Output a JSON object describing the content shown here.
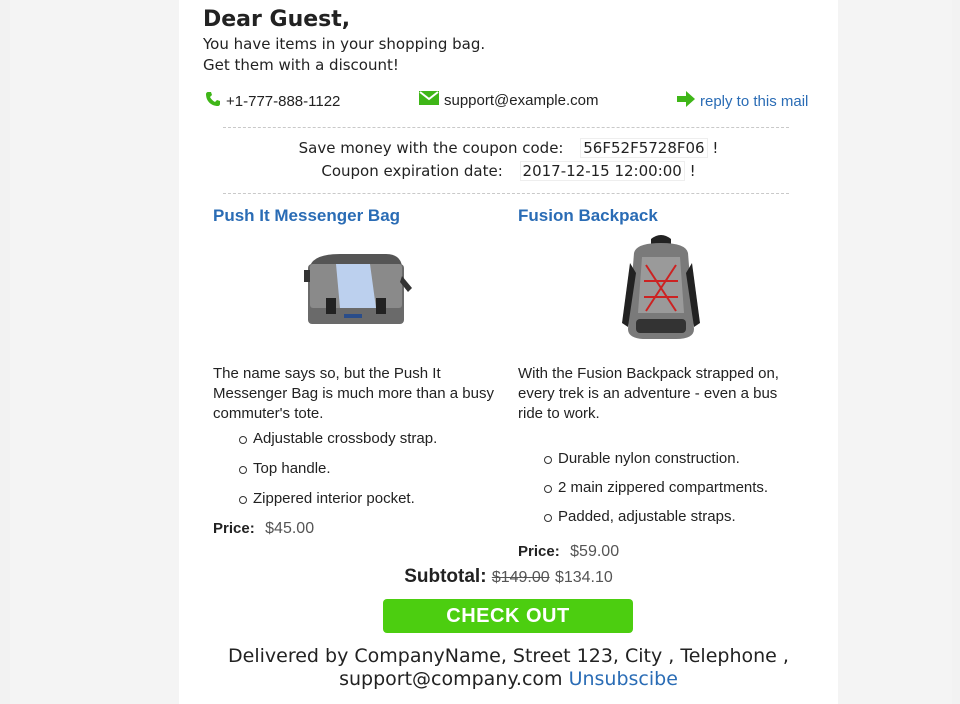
{
  "greeting": {
    "title": "Dear Guest,",
    "line1": "You have items in your shopping bag.",
    "line2": "Get them with a discount!"
  },
  "contacts": {
    "phone": "+1-777-888-1122",
    "email": "support@example.com",
    "reply": "reply to this mail"
  },
  "coupon": {
    "code_label": "Save money with the coupon code:",
    "code": "56F52F5728F06",
    "code_suffix": "!",
    "expire_label": "Coupon expiration date:",
    "expire": "2017-12-15 12:00:00",
    "expire_suffix": "!"
  },
  "products": [
    {
      "title": "Push It Messenger Bag",
      "description": "The name says so, but the Push It Messenger Bag is much more than a busy commuter's tote.",
      "features": [
        "Adjustable crossbody strap.",
        "Top handle.",
        "Zippered interior pocket."
      ],
      "price_label": "Price:",
      "price": "$45.00"
    },
    {
      "title": "Fusion Backpack",
      "description": "With the Fusion Backpack strapped on, every trek is an adventure - even a bus ride to work.",
      "features": [
        "Durable nylon construction.",
        "2 main zippered compartments.",
        "Padded, adjustable straps."
      ],
      "price_label": "Price:",
      "price": "$59.00"
    }
  ],
  "subtotal": {
    "label": "Subtotal:",
    "old": "$149.00",
    "new": "$134.10"
  },
  "checkout_label": "CHECK OUT",
  "footer": {
    "line1": "Delivered by CompanyName, Street 123, City , Telephone ,",
    "email": "support@company.com",
    "unsubscribe": "Unsubscibe"
  },
  "colors": {
    "link": "#2a6cb5",
    "checkout": "#4cce10",
    "icon_green": "#3fb618"
  }
}
